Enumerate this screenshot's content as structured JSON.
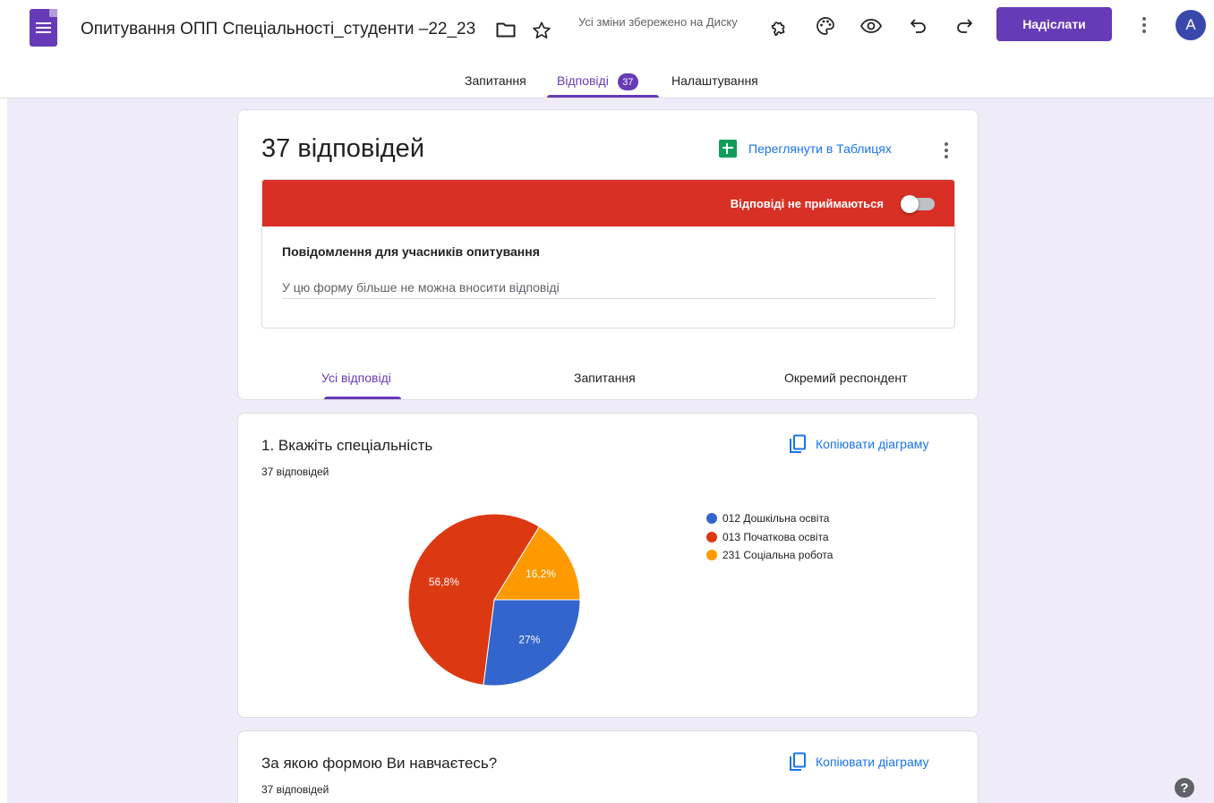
{
  "header": {
    "title": "Опитування ОПП Спеціальності_студенти –22_23",
    "save_status": "Усі зміни збережено на Диску",
    "send_label": "Надіслати",
    "avatar_letter": "A"
  },
  "tabs": [
    {
      "label": "Запитання"
    },
    {
      "label": "Відповіді",
      "count": "37"
    },
    {
      "label": "Налаштування"
    }
  ],
  "summary": {
    "title": "37 відповідей",
    "sheets_link": "Переглянути в Таблицях",
    "accepting_label": "Відповіді не приймаються",
    "accepting": false,
    "message_label": "Повідомлення для учасників опитування",
    "message_placeholder": "У цю форму більше не можна вносити відповіді",
    "sub_tabs": [
      "Усі відповіді",
      "Запитання",
      "Окремий респондент"
    ]
  },
  "questions": [
    {
      "title": "1. Вкажіть спеціальність",
      "count": "37 відповідей",
      "copy_label": "Копіювати діаграму"
    },
    {
      "title": "За якою формою Ви навчаєтесь?",
      "count": "37 відповідей",
      "copy_label": "Копіювати діаграму"
    }
  ],
  "chart_data": {
    "type": "pie",
    "categories": [
      "012 Дошкільна освіта",
      "013 Початкова освіта",
      "231 Соціальна робота"
    ],
    "values": [
      27,
      56.8,
      16.2
    ],
    "labels": [
      "27%",
      "56,8%",
      "16,2%"
    ],
    "colors": [
      "#3366cc",
      "#dc3912",
      "#ff9900"
    ],
    "legend": "right"
  },
  "colors": {
    "accent": "#673ab7",
    "closed_banner": "#d93025",
    "link": "#1a73e8",
    "page_bg": "#f0ebf8"
  },
  "icons": [
    "forms-logo-icon",
    "folder-icon",
    "star-icon",
    "addon-icon",
    "palette-icon",
    "preview-eye-icon",
    "undo-icon",
    "redo-icon",
    "more-vert-icon",
    "sheets-icon",
    "copy-icon",
    "help-icon"
  ]
}
